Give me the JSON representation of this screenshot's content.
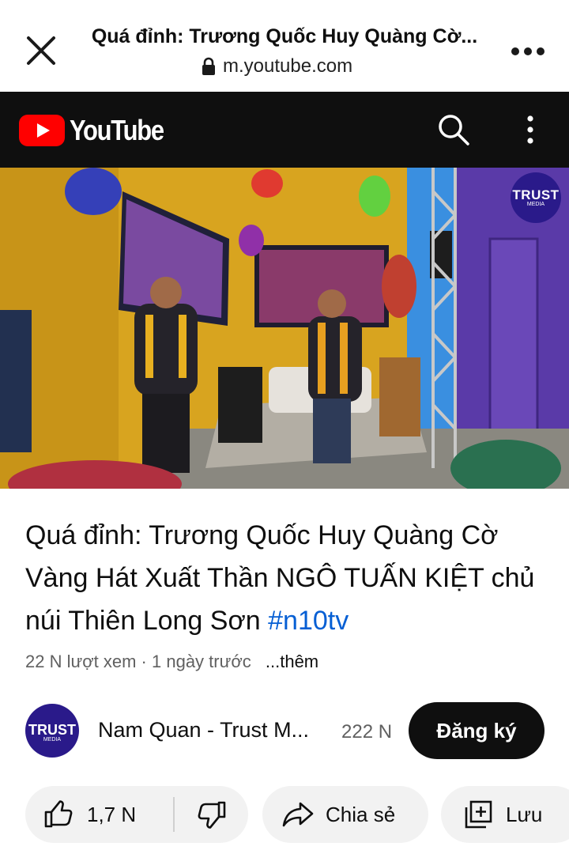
{
  "browser": {
    "title": "Quá đỉnh: Trương Quốc Huy Quàng Cờ...",
    "url": "m.youtube.com"
  },
  "youtube": {
    "logo_text": "YouTube"
  },
  "video": {
    "overlay_logo": {
      "line1": "TRUST",
      "line2": "MEDIA"
    },
    "title": "Quá đỉnh: Trương Quốc Huy Quàng Cờ Vàng Hát Xuất Thần NGÔ TUẤN KIỆT chủ núi Thiên Long Sơn",
    "hashtag": "#n10tv",
    "views": "22 N lượt xem",
    "separator": "·",
    "time": "1 ngày trước",
    "more": "...thêm"
  },
  "channel": {
    "avatar": {
      "line1": "TRUST",
      "line2": "MEDIA"
    },
    "name": "Nam Quan - Trust M...",
    "subscribers": "222 N",
    "subscribe_label": "Đăng ký"
  },
  "actions": {
    "likes": "1,7 N",
    "share_label": "Chia sẻ",
    "save_label": "Lưu"
  },
  "colors": {
    "youtube_red": "#ff0000",
    "header_bg": "#0f0f0f",
    "hashtag_blue": "#065fd4",
    "trust_blue": "#2a1a8a"
  }
}
